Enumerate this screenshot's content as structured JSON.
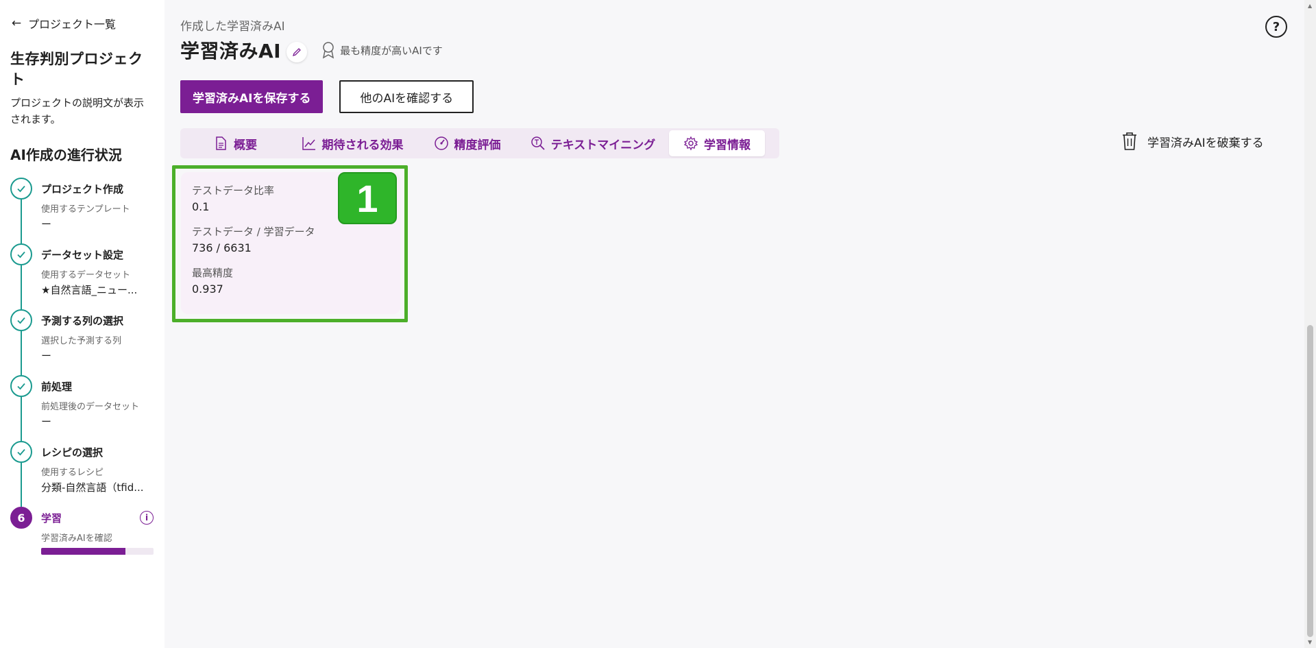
{
  "sidebar": {
    "back_label": "プロジェクト一覧",
    "project_title": "生存判別プロジェクト",
    "project_desc": "プロジェクトの説明文が表示されます。",
    "progress_title": "AI作成の進行状況",
    "steps": [
      {
        "title": "プロジェクト作成",
        "sub": "使用するテンプレート",
        "value": "ー"
      },
      {
        "title": "データセット設定",
        "sub": "使用するデータセット",
        "value": "★自然言語_ニュー..."
      },
      {
        "title": "予測する列の選択",
        "sub": "選択した予測する列",
        "value": "ー"
      },
      {
        "title": "前処理",
        "sub": "前処理後のデータセット",
        "value": "ー"
      },
      {
        "title": "レシピの選択",
        "sub": "使用するレシピ",
        "value": "分類-自然言語（tfid..."
      },
      {
        "number": "6",
        "title": "学習",
        "sub": "学習済みAIを確認",
        "progress": 0.75
      }
    ]
  },
  "header": {
    "breadcrumb": "作成した学習済みAI",
    "title": "学習済みAI",
    "badge": "最も精度が高いAIです",
    "save_button": "学習済みAIを保存する",
    "other_button": "他のAIを確認する",
    "discard_label": "学習済みAIを破棄する",
    "help_icon": "?"
  },
  "tabs": [
    {
      "label": "概要",
      "icon": "document-icon"
    },
    {
      "label": "期待される効果",
      "icon": "chart-icon"
    },
    {
      "label": "精度評価",
      "icon": "gauge-icon"
    },
    {
      "label": "テキストマイニング",
      "icon": "text-search-icon"
    },
    {
      "label": "学習情報",
      "icon": "gear-icon",
      "active": true
    }
  ],
  "info_card": {
    "test_ratio_label": "テストデータ比率",
    "test_ratio_value": "0.1",
    "split_label": "テストデータ / 学習データ",
    "split_value": "736 / 6631",
    "accuracy_label": "最高精度",
    "accuracy_value": "0.937"
  },
  "annotation": {
    "number": "1",
    "color": "#2fb52a"
  },
  "colors": {
    "accent": "#7b1e94",
    "step_done": "#1a9a8f",
    "highlight": "#4caf2a"
  }
}
